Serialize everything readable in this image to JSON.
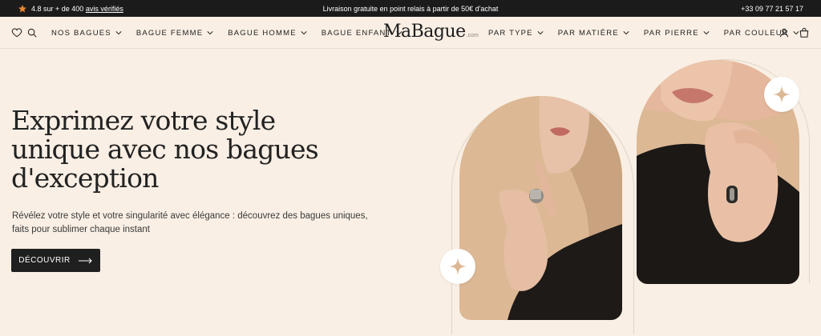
{
  "topbar": {
    "rating_text": "4.8 sur + de 400",
    "rating_link": "avis vérifiés",
    "shipping": "Livraison gratuite en point relais à partir de 50€ d'achat",
    "phone": "+33 09 77 21 57 17"
  },
  "nav": {
    "left_items": [
      {
        "label": "NOS BAGUES"
      },
      {
        "label": "BAGUE FEMME"
      },
      {
        "label": "BAGUE HOMME"
      },
      {
        "label": "BAGUE ENFANT"
      }
    ],
    "logo": "MaBague",
    "logo_suffix": ".com",
    "right_items": [
      {
        "label": "PAR TYPE"
      },
      {
        "label": "PAR MATIÈRE"
      },
      {
        "label": "PAR PIERRE"
      },
      {
        "label": "PAR COULEUR"
      }
    ]
  },
  "hero": {
    "title_lines": [
      "Exprimez votre style",
      "unique avec nos bagues",
      "d'exception"
    ],
    "subtitle_line1": "Révélez votre style et votre singularité avec élégance : découvrez des bagues uniques,",
    "subtitle_line2": "faits pour sublimer chaque instant",
    "cta": "DÉCOUVRIR"
  },
  "colors": {
    "background": "#f9efe4",
    "topbar": "#1b1b1b",
    "accent_star": "#e8862c",
    "image_bg": "#dcb895"
  }
}
